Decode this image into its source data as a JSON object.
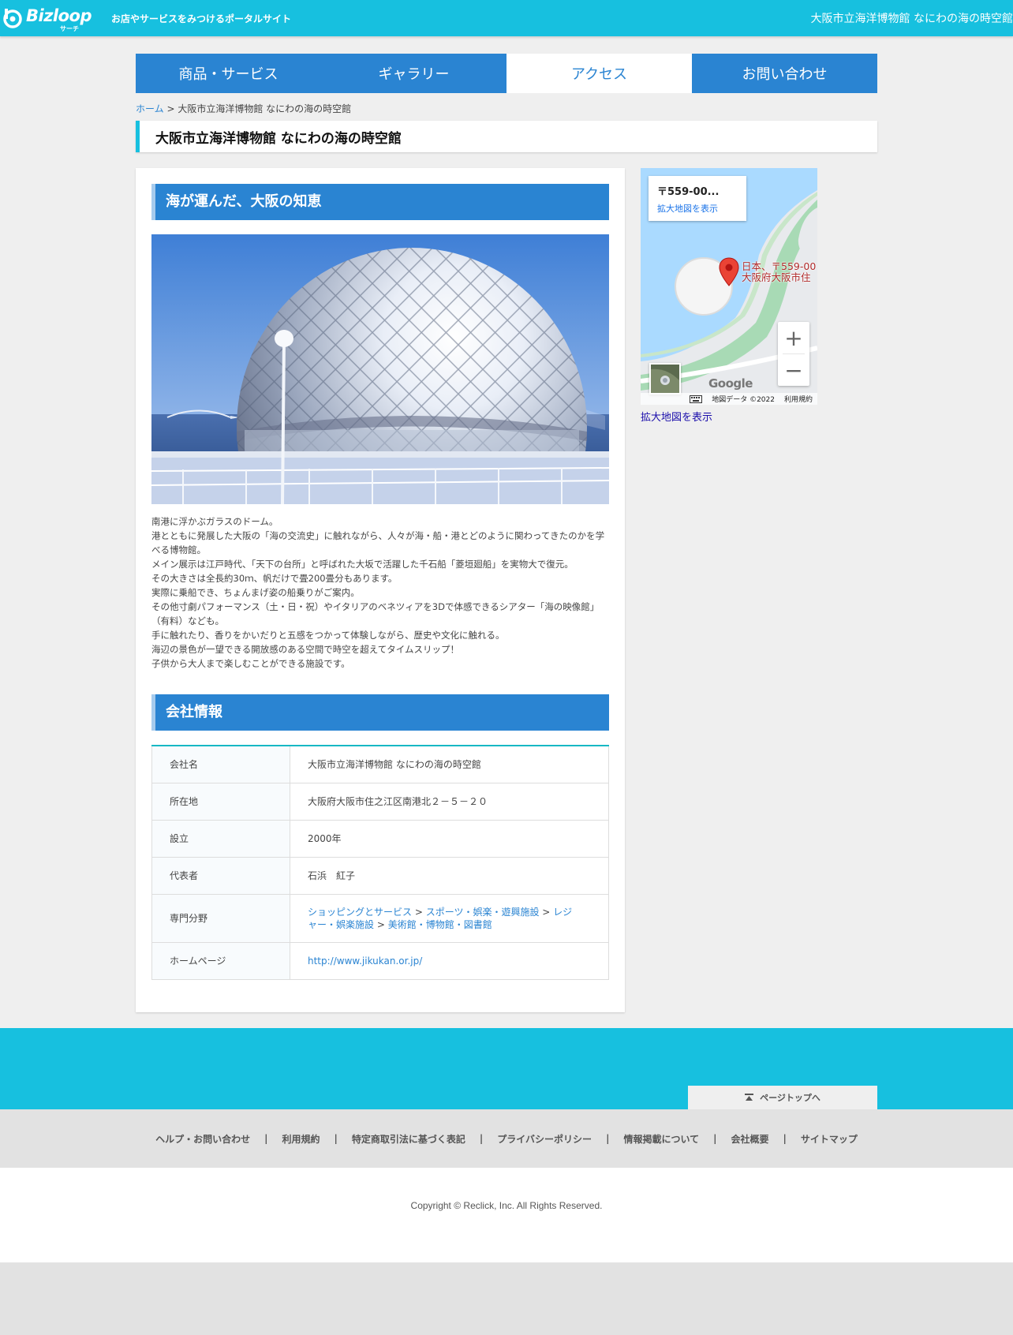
{
  "header": {
    "logo_text": "Bizloop",
    "logo_sub": "サーチ",
    "tagline": "お店やサービスをみつけるポータルサイト",
    "title": "大阪市立海洋博物館 なにわの海の時空館"
  },
  "tabs": [
    {
      "label": "商品・サービス"
    },
    {
      "label": "ギャラリー"
    },
    {
      "label": "アクセス"
    },
    {
      "label": "お問い合わせ"
    }
  ],
  "breadcrumb": {
    "home": "ホーム",
    "separator": " > ",
    "current": "大阪市立海洋博物館 なにわの海の時空館"
  },
  "page_title": "大阪市立海洋博物館 なにわの海の時空館",
  "intro": {
    "heading": "海が運んだ、大阪の知恵",
    "paragraphs": [
      "南港に浮かぶガラスのドーム。",
      "港とともに発展した大阪の「海の交流史」に触れながら、人々が海・船・港とどのように関わってきたのかを学べる博物館。",
      "メイン展示は江戸時代、「天下の台所」と呼ばれた大坂で活躍した千石船「菱垣廻船」を実物大で復元。",
      "その大きさは全長約30ｍ、帆だけで畳200畳分もあります。",
      "実際に乗船でき、ちょんまげ姿の船乗りがご案内。",
      "その他寸劇パフォーマンス（土・日・祝）やイタリアのベネツィアを3Dで体感できるシアター「海の映像館」（有料）なども。",
      "手に触れたり、香りをかいだりと五感をつかって体験しながら、歴史や文化に触れる。",
      "海辺の景色が一望できる開放感のある空間で時空を超えてタイムスリップ！",
      "子供から大人まで楽しむことができる施設です。"
    ]
  },
  "company": {
    "heading": "会社情報",
    "rows": {
      "name": {
        "key": "会社名",
        "value": "大阪市立海洋博物館 なにわの海の時空館"
      },
      "address": {
        "key": "所在地",
        "value": "大阪府大阪市住之江区南港北２－５－２０"
      },
      "founded": {
        "key": "設立",
        "value": "2000年"
      },
      "representative": {
        "key": "代表者",
        "value": "石浜　紅子"
      },
      "category": {
        "key": "専門分野",
        "links": [
          "ショッピングとサービス",
          "スポーツ・娯楽・遊興施設",
          "レジャー・娯楽施設",
          "美術館・博物館・図書館"
        ],
        "separator": " > "
      },
      "homepage": {
        "key": "ホームページ",
        "value": "http://www.jikukan.or.jp/"
      }
    }
  },
  "map": {
    "card_address": "〒559-00...",
    "card_link": "拡大地図を表示",
    "pin_label_line1": "日本、〒559-00",
    "pin_label_line2": "大阪府大阪市住",
    "zoom_in": "+",
    "zoom_out": "−",
    "google": "Google",
    "attribution": "地図データ ©2022",
    "terms": "利用規約",
    "below_link": "拡大地図を表示"
  },
  "footer": {
    "pagetop": "ページトップへ",
    "links": [
      "ヘルプ・お問い合わせ",
      "利用規約",
      "特定商取引法に基づく表記",
      "プライバシーポリシー",
      "情報掲載について",
      "会社概要",
      "サイトマップ"
    ],
    "separator": "|",
    "copyright": "Copyright © Reclick, Inc. All Rights Reserved."
  },
  "colors": {
    "header_cyan": "#17c0df",
    "tab_blue": "#2a84d2",
    "table_accent": "#17b8c4"
  }
}
